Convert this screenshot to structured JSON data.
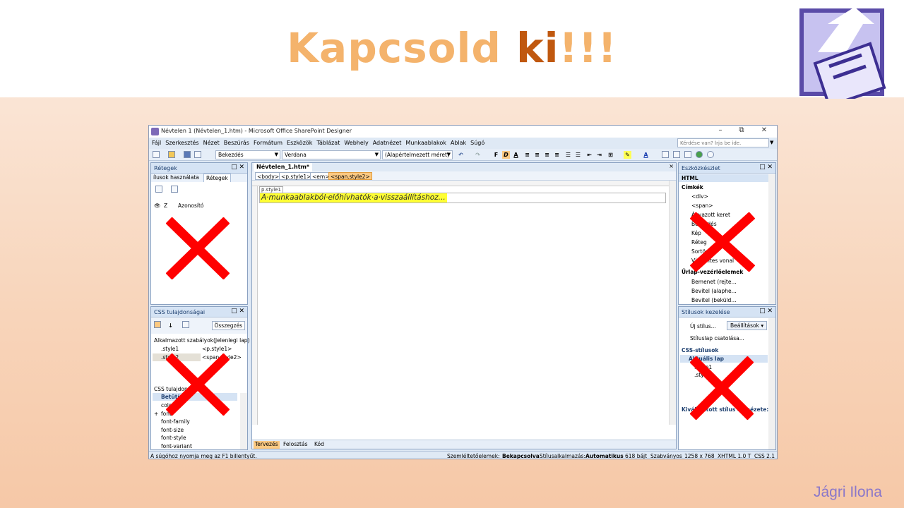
{
  "slide": {
    "title_main": "Kapcsold ",
    "title_emph": "ki",
    "title_end": "!!!",
    "author": "Jágri Ilona"
  },
  "window": {
    "title": "Névtelen 1 (Névtelen_1.htm) - Microsoft Office SharePoint Designer",
    "minimize": "–",
    "restore": "⧉",
    "close": "✕"
  },
  "menu": {
    "items": [
      "Fájl",
      "Szerkesztés",
      "Nézet",
      "Beszúrás",
      "Formátum",
      "Eszközök",
      "Táblázat",
      "Webhely",
      "Adatnézet",
      "Munkaablakok",
      "Ablak",
      "Súgó"
    ],
    "help_placeholder": "Kérdése van? Írja be ide."
  },
  "toolbar": {
    "style_combo": "Bekezdés",
    "font_combo": "Verdana",
    "size_combo": "(Alapértelmezett méret)",
    "bold": "F",
    "italic": "D",
    "font_color": "A"
  },
  "layers_panel": {
    "title": "Rétegek",
    "tab1": "ílusok használata",
    "tab2": "Rétegek",
    "col_z": "Z",
    "col_id": "Azonosító"
  },
  "css_panel": {
    "title": "CSS tulajdonságai",
    "summary_button": "Összegzés",
    "rules_header": "Alkalmazott szabályok",
    "rules_location": "(Jelenlegi lap)",
    "rules": [
      {
        "name": ".style1",
        "tag": "<p.style1>"
      },
      {
        "name": ".style2",
        "tag": "<span.style2>"
      }
    ],
    "props_header": "CSS tulajdonságai",
    "group": "Betűtípus",
    "props": [
      "color",
      "font",
      "font-family",
      "font-size",
      "font-style",
      "font-variant"
    ]
  },
  "editor": {
    "doc_tab": "Névtelen_1.htm*",
    "breadcrumbs": [
      "<body>",
      "<p.style1>",
      "<em>",
      "<span.style2>"
    ],
    "p_label": "p.style1",
    "content": "A·munkaablakból·előhívhatók·a·visszaállításhoz...",
    "view_tabs": [
      "Tervezés",
      "Felosztás",
      "Kód"
    ]
  },
  "toolbox_panel": {
    "title": "Eszközkészlet",
    "section_html": "HTML",
    "section_tags": "Címkék",
    "items": [
      "<div>",
      "<span>",
      "Ágyazott keret",
      "Bekezdés",
      "Kép",
      "Réteg",
      "Sortörés",
      "Vízszintes vonal"
    ],
    "section_form": "Űrlap-vezérlőelemek",
    "form_items": [
      "Bemenet (rejte...",
      "Bevitel (alaphe...",
      "Bevitel (beküld..."
    ]
  },
  "styles_panel": {
    "title": "Stílusok kezelése",
    "new_style": "Új stílus...",
    "options": "Beállítások",
    "attach": "Stíluslap csatolása...",
    "css_styles": "CSS-stílusok",
    "current_page": "Aktuális lap",
    "styles": [
      ".style1",
      ".style2"
    ],
    "preview_label": "Kiválasztott stílus előnézete:"
  },
  "statusbar": {
    "hint": "A súgóhoz nyomja meg az F1 billentyűt.",
    "visual_aids_label": "Szemléltetőelemek:",
    "visual_aids_value": "Bekapcsolva",
    "style_app_label": "Stílusalkalmazás:",
    "style_app_value": "Automatikus",
    "size": "618 bájt",
    "standard": "Szabványos",
    "resolution": "1258 x 768",
    "doctype": "XHTML 1.0 T",
    "css": "CSS 2.1"
  },
  "colors": {
    "title_light": "#f4b36c",
    "title_emph": "#c0580f",
    "cross": "#ff0000",
    "highlight": "#ffff33"
  }
}
